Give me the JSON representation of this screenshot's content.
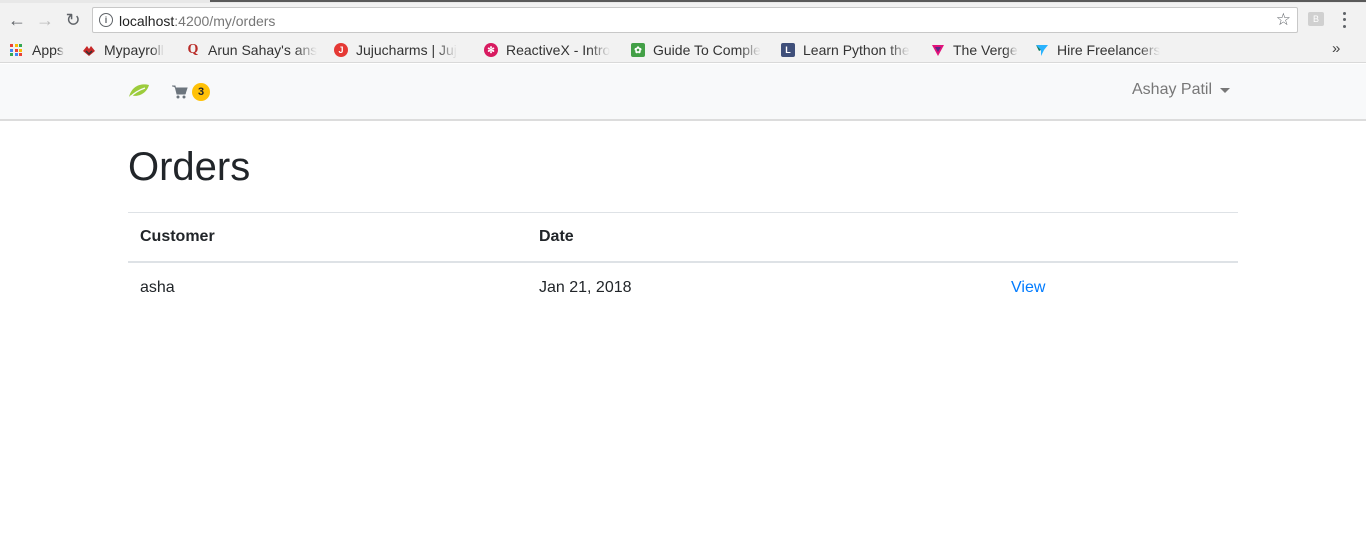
{
  "browser": {
    "url_host": "localhost",
    "url_path": ":4200/my/orders",
    "bookmarks": [
      {
        "label": "Apps",
        "icon": "apps-grid-icon"
      },
      {
        "label": "Mypayroll",
        "icon": "mypayroll-icon"
      },
      {
        "label": "Arun Sahay's ans",
        "icon": "quora-icon"
      },
      {
        "label": "Jujucharms | Juj",
        "icon": "jujucharms-icon"
      },
      {
        "label": "ReactiveX - Intro",
        "icon": "reactivex-icon"
      },
      {
        "label": "Guide To Comple",
        "icon": "guide-leaf-icon"
      },
      {
        "label": "Learn Python the",
        "icon": "learn-python-icon"
      },
      {
        "label": "The Verge",
        "icon": "verge-icon"
      },
      {
        "label": "Hire Freelancers",
        "icon": "freelancer-icon"
      }
    ],
    "overflow_label": "»"
  },
  "navbar": {
    "brand_icon": "leaf-logo-icon",
    "cart_icon": "shopping-cart-icon",
    "cart_count": "3",
    "user_name": "Ashay Patil"
  },
  "page": {
    "title": "Orders",
    "columns": [
      "Customer",
      "Date",
      ""
    ],
    "rows": [
      {
        "customer": "asha",
        "date": "Jan 21, 2018",
        "action": "View"
      }
    ]
  },
  "colors": {
    "badge": "#ffc107",
    "link": "#007bff",
    "brand": "#8bc34a"
  }
}
